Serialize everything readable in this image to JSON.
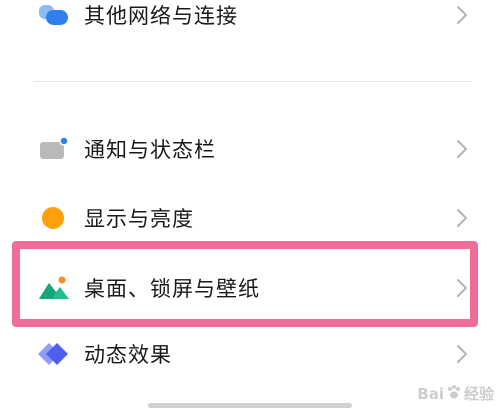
{
  "settings": {
    "items": [
      {
        "label": "其他网络与连接",
        "icon": "link-icon",
        "icon_color": "#2f80ed"
      },
      {
        "label": "通知与状态栏",
        "icon": "notification-icon",
        "icon_color": "#9e9e9e",
        "dot_color": "#2f80ed"
      },
      {
        "label": "显示与亮度",
        "icon": "brightness-icon",
        "icon_color": "#ff9f0a"
      },
      {
        "label": "桌面、锁屏与壁纸",
        "icon": "wallpaper-icon",
        "icon_color": "#1fbf8f",
        "dot_color": "#ff8a2a"
      },
      {
        "label": "动态效果",
        "icon": "animation-icon",
        "icon_color": "#5b6bf5"
      }
    ],
    "chevron": "chevron-right-icon"
  },
  "highlight_color": "#f06d97",
  "watermark": {
    "text": "Bai",
    "subtext": "经验"
  }
}
